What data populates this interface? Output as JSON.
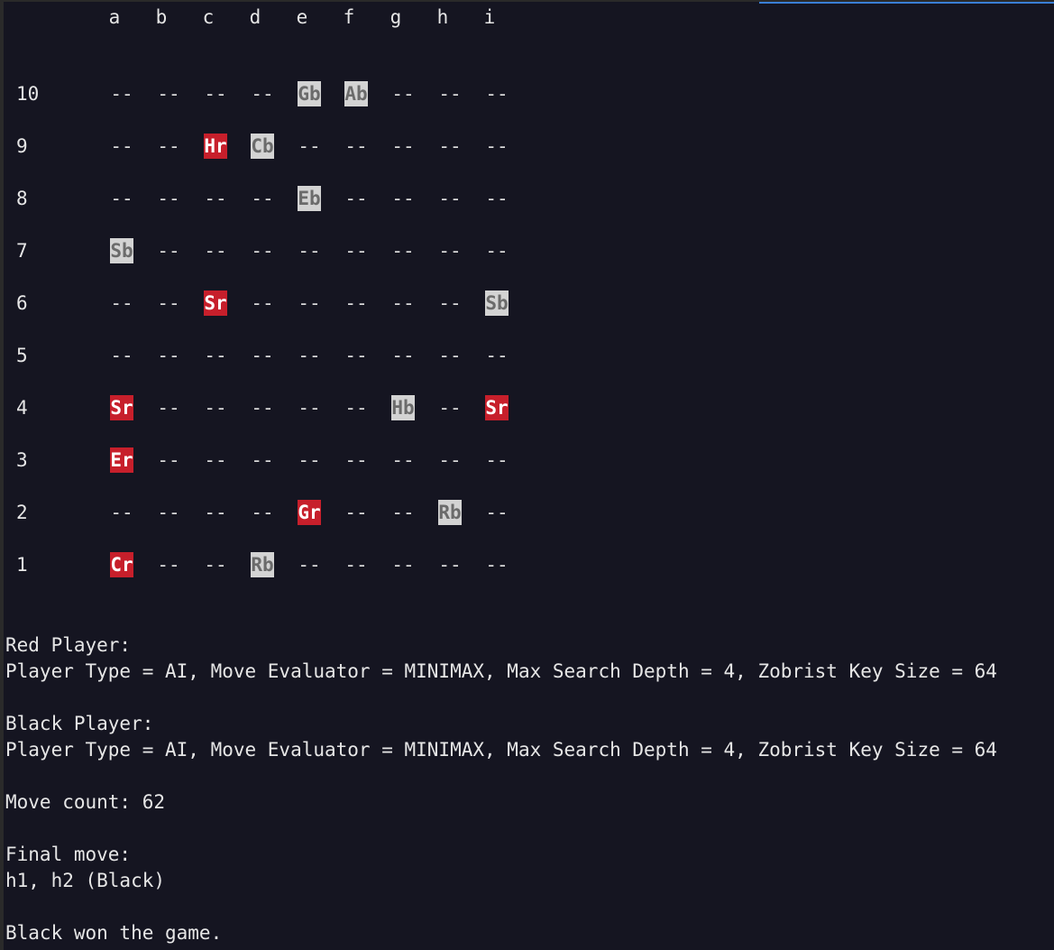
{
  "board": {
    "files": [
      "a",
      "b",
      "c",
      "d",
      "e",
      "f",
      "g",
      "h",
      "i"
    ],
    "ranks": [
      "10",
      "9",
      "8",
      "7",
      "6",
      "5",
      "4",
      "3",
      "2",
      "1"
    ],
    "empty": "--",
    "colors": {
      "red_piece_bg": "#c71f2b",
      "black_piece_bg": "#d3d3d3",
      "background": "#151521"
    },
    "rows": [
      [
        "--",
        "--",
        "--",
        "--",
        "Gb",
        "Ab",
        "--",
        "--",
        "--"
      ],
      [
        "--",
        "--",
        "Hr",
        "Cb",
        "--",
        "--",
        "--",
        "--",
        "--"
      ],
      [
        "--",
        "--",
        "--",
        "--",
        "Eb",
        "--",
        "--",
        "--",
        "--"
      ],
      [
        "Sb",
        "--",
        "--",
        "--",
        "--",
        "--",
        "--",
        "--",
        "--"
      ],
      [
        "--",
        "--",
        "Sr",
        "--",
        "--",
        "--",
        "--",
        "--",
        "Sb"
      ],
      [
        "--",
        "--",
        "--",
        "--",
        "--",
        "--",
        "--",
        "--",
        "--"
      ],
      [
        "Sr",
        "--",
        "--",
        "--",
        "--",
        "--",
        "Hb",
        "--",
        "Sr"
      ],
      [
        "Er",
        "--",
        "--",
        "--",
        "--",
        "--",
        "--",
        "--",
        "--"
      ],
      [
        "--",
        "--",
        "--",
        "--",
        "Gr",
        "--",
        "--",
        "Rb",
        "--"
      ],
      [
        "Cr",
        "--",
        "--",
        "Rb",
        "--",
        "--",
        "--",
        "--",
        "--"
      ]
    ]
  },
  "info": {
    "red_header": "Red Player:",
    "red_details": "Player Type = AI, Move Evaluator = MINIMAX, Max Search Depth = 4, Zobrist Key Size = 64",
    "black_header": "Black Player:",
    "black_details": "Player Type = AI, Move Evaluator = MINIMAX, Max Search Depth = 4, Zobrist Key Size = 64",
    "move_count": "Move count: 62",
    "final_move_header": "Final move:",
    "final_move": "h1, h2 (Black)",
    "result": "Black won the game."
  }
}
